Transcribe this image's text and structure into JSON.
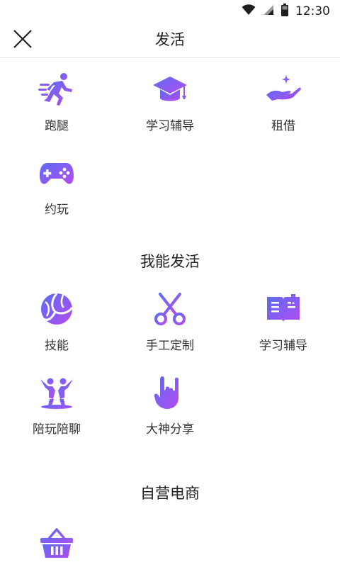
{
  "status_bar": {
    "time": "12:30",
    "icons": [
      "wifi-icon",
      "signal-icon",
      "battery-icon"
    ]
  },
  "header": {
    "title": "发活",
    "close_icon": "close-icon"
  },
  "colors": {
    "accent_start": "#5b6cf2",
    "accent_end": "#b44cf0",
    "text": "#333333",
    "divider": "#e5e5e5"
  },
  "post_types": {
    "items": [
      {
        "label": "跑腿",
        "icon": "runner-icon"
      },
      {
        "label": "学习辅导",
        "icon": "graduation-cap-icon"
      },
      {
        "label": "租借",
        "icon": "hand-sparkle-icon"
      },
      {
        "label": "约玩",
        "icon": "gamepad-icon"
      }
    ]
  },
  "skills_section": {
    "title": "我能发活",
    "items": [
      {
        "label": "技能",
        "icon": "volleyball-icon"
      },
      {
        "label": "手工定制",
        "icon": "scissors-icon"
      },
      {
        "label": "学习辅导",
        "icon": "book-icon"
      },
      {
        "label": "陪玩陪聊",
        "icon": "people-dancing-icon"
      },
      {
        "label": "大神分享",
        "icon": "rock-hand-icon"
      }
    ]
  },
  "shop_section": {
    "title": "自营电商",
    "items": [
      {
        "icon": "basket-icon"
      }
    ]
  }
}
